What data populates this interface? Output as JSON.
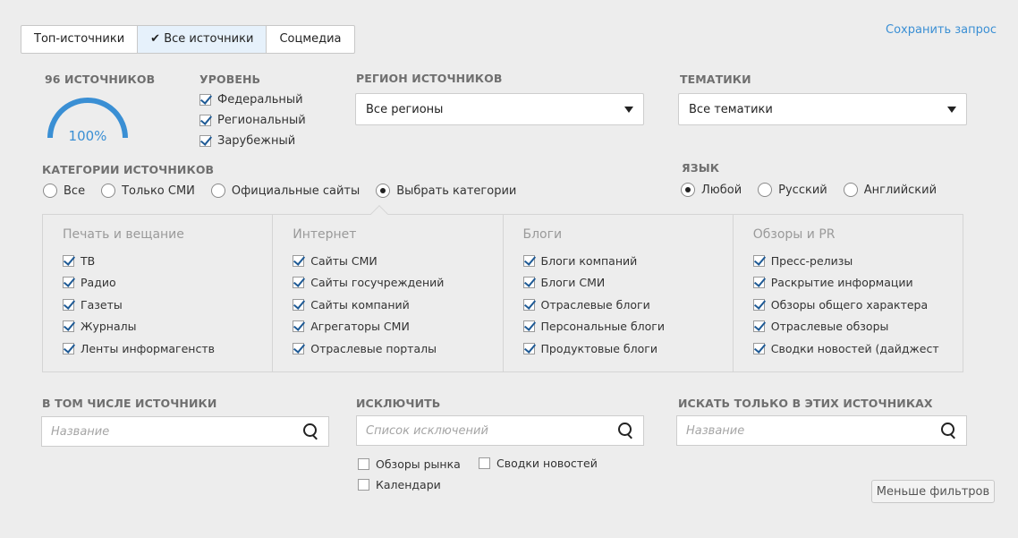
{
  "tabs": [
    {
      "label": "Топ-источники",
      "active": false
    },
    {
      "label": "Все источники",
      "active": true,
      "check": "✔"
    },
    {
      "label": "Соцмедиа",
      "active": false
    }
  ],
  "save_link": "Сохранить запрос",
  "sources": {
    "count_label": "96 ИСТОЧНИКОВ",
    "gauge_percent": 100,
    "gauge_text": "100%",
    "gauge_color": "#3a8fd4"
  },
  "level": {
    "title": "УРОВЕНЬ",
    "items": [
      {
        "label": "Федеральный",
        "checked": true
      },
      {
        "label": "Региональный",
        "checked": true
      },
      {
        "label": "Зарубежный",
        "checked": true
      }
    ]
  },
  "region": {
    "title": "РЕГИОН ИСТОЧНИКОВ",
    "value": "Все регионы"
  },
  "topics": {
    "title": "ТЕМАТИКИ",
    "value": "Все тематики"
  },
  "categories": {
    "title": "КАТЕГОРИИ ИСТОЧНИКОВ",
    "options": [
      {
        "label": "Все",
        "selected": false
      },
      {
        "label": "Только СМИ",
        "selected": false
      },
      {
        "label": "Официальные сайты",
        "selected": false
      },
      {
        "label": "Выбрать категории",
        "selected": true
      }
    ],
    "columns": [
      {
        "title": "Печать и вещание",
        "items": [
          "ТВ",
          "Радио",
          "Газеты",
          "Журналы",
          "Ленты информагенств"
        ]
      },
      {
        "title": "Интернет",
        "items": [
          "Сайты СМИ",
          "Сайты госучреждений",
          "Сайты компаний",
          "Агрегаторы СМИ",
          "Отраслевые порталы"
        ]
      },
      {
        "title": "Блоги",
        "items": [
          "Блоги компаний",
          "Блоги СМИ",
          "Отраслевые блоги",
          "Персональные блоги",
          "Продуктовые блоги"
        ]
      },
      {
        "title": "Обзоры и PR",
        "items": [
          "Пресс-релизы",
          "Раскрытие информации",
          "Обзоры общего характера",
          "Отраслевые обзоры",
          "Сводки новостей (дайджест"
        ]
      }
    ]
  },
  "language": {
    "title": "ЯЗЫК",
    "options": [
      {
        "label": "Любой",
        "selected": true
      },
      {
        "label": "Русский",
        "selected": false
      },
      {
        "label": "Английский",
        "selected": false
      }
    ]
  },
  "include": {
    "title": "В ТОМ ЧИСЛЕ ИСТОЧНИКИ",
    "placeholder": "Название",
    "search_icon": "search-icon"
  },
  "exclude": {
    "title": "ИСКЛЮЧИТЬ",
    "placeholder": "Список исключений",
    "checkboxes": [
      {
        "label": "Обзоры рынка",
        "checked": false
      },
      {
        "label": "Сводки новостей",
        "checked": false
      },
      {
        "label": "Календари",
        "checked": false
      }
    ]
  },
  "only_these": {
    "title": "ИСКАТЬ ТОЛЬКО В ЭТИХ ИСТОЧНИКАХ",
    "placeholder": "Название"
  },
  "less_filters": "Меньше фильтров"
}
